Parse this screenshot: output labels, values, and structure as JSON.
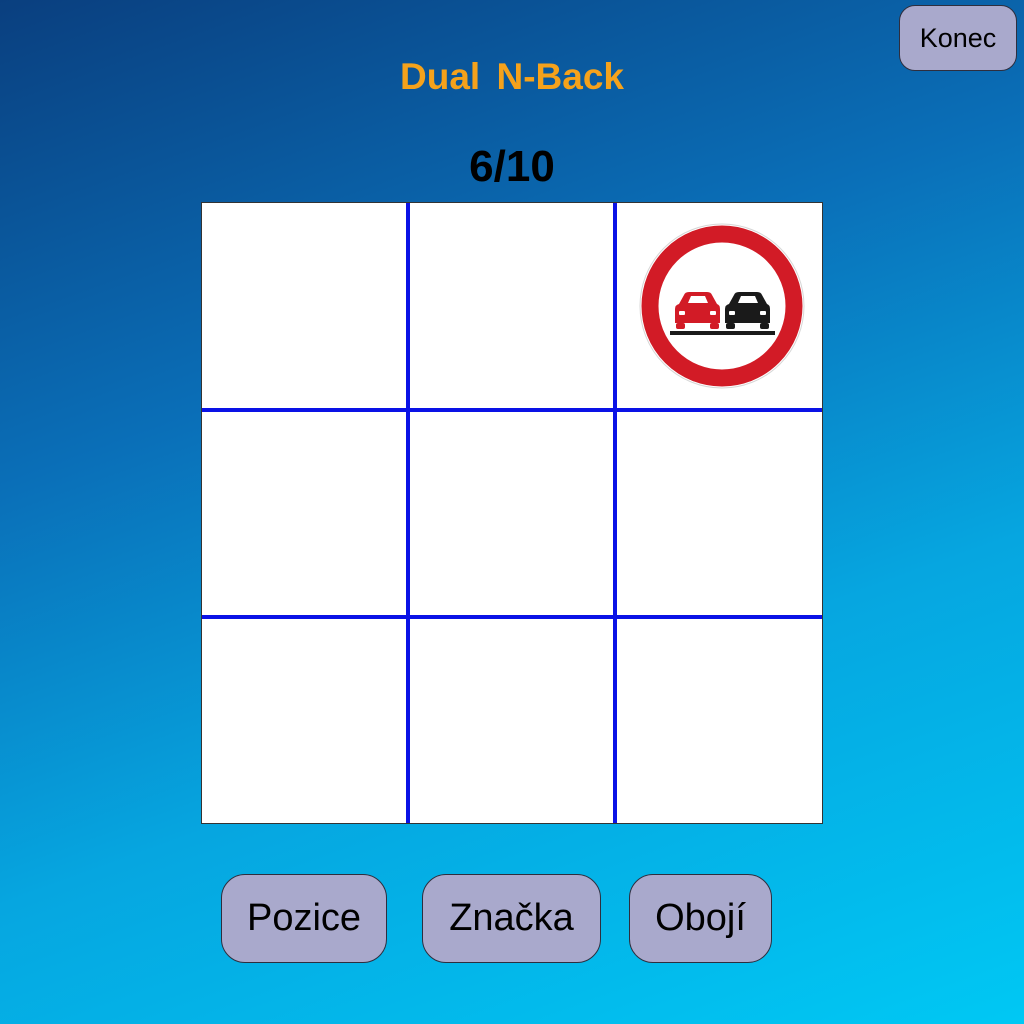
{
  "header": {
    "title": "Dual  N-Back",
    "exit_label": "Konec"
  },
  "progress": {
    "label": "6/10",
    "current": 6,
    "total": 10
  },
  "grid": {
    "rows": 3,
    "cols": 3,
    "active_cell": {
      "row": 1,
      "col": 3
    },
    "stimulus": "no-overtaking-sign-icon"
  },
  "buttons": {
    "position_label": "Pozice",
    "sign_label": "Značka",
    "both_label": "Obojí"
  },
  "colors": {
    "title": "#f5a21b",
    "grid_lines": "#0a12e6",
    "button_fill": "#a9a9cc",
    "sign_ring": "#d21b26"
  }
}
